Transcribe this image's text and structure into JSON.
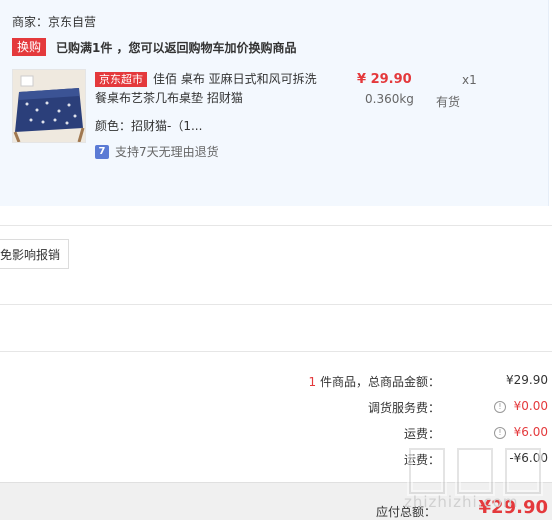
{
  "order": {
    "merchant": "商家：京东自营",
    "promo_tag": "换购",
    "promo_text": "已购满1件 ，您可以返回购物车加价换购商品",
    "product": {
      "store_tag": "京东超市",
      "title": "佳佰 桌布 亚麻日式和风可拆洗餐桌布艺茶几布桌垫 招财猫",
      "price": "¥ 29.90",
      "weight": "0.360kg",
      "quantity": "x1",
      "stock": "有货",
      "color": "颜色：招财猫-（1...",
      "return_icon": "7",
      "return_policy": "支持7天无理由退货"
    }
  },
  "invoice": {
    "button_label": "免影响报销"
  },
  "summary": {
    "item_count": "1",
    "item_label": " 件商品，总商品金额：",
    "item_total": "¥29.90",
    "service_label": "调货服务费：",
    "service_value": "¥0.00",
    "shipping_label": "运费：",
    "shipping_value": "¥6.00",
    "shipping_discount_label": "运费：",
    "shipping_discount_value": "-¥6.00",
    "total_label": "应付总额：",
    "total_value": "¥29.90"
  },
  "watermark": {
    "text": "zhizhizhi.com"
  },
  "colors": {
    "accent": "#e4393c",
    "panel_bg": "#f3f8fe",
    "footer_bg": "#f0f0f0"
  },
  "icons": {
    "info": "info-circle-icon",
    "return": "seven-day-return-icon"
  }
}
